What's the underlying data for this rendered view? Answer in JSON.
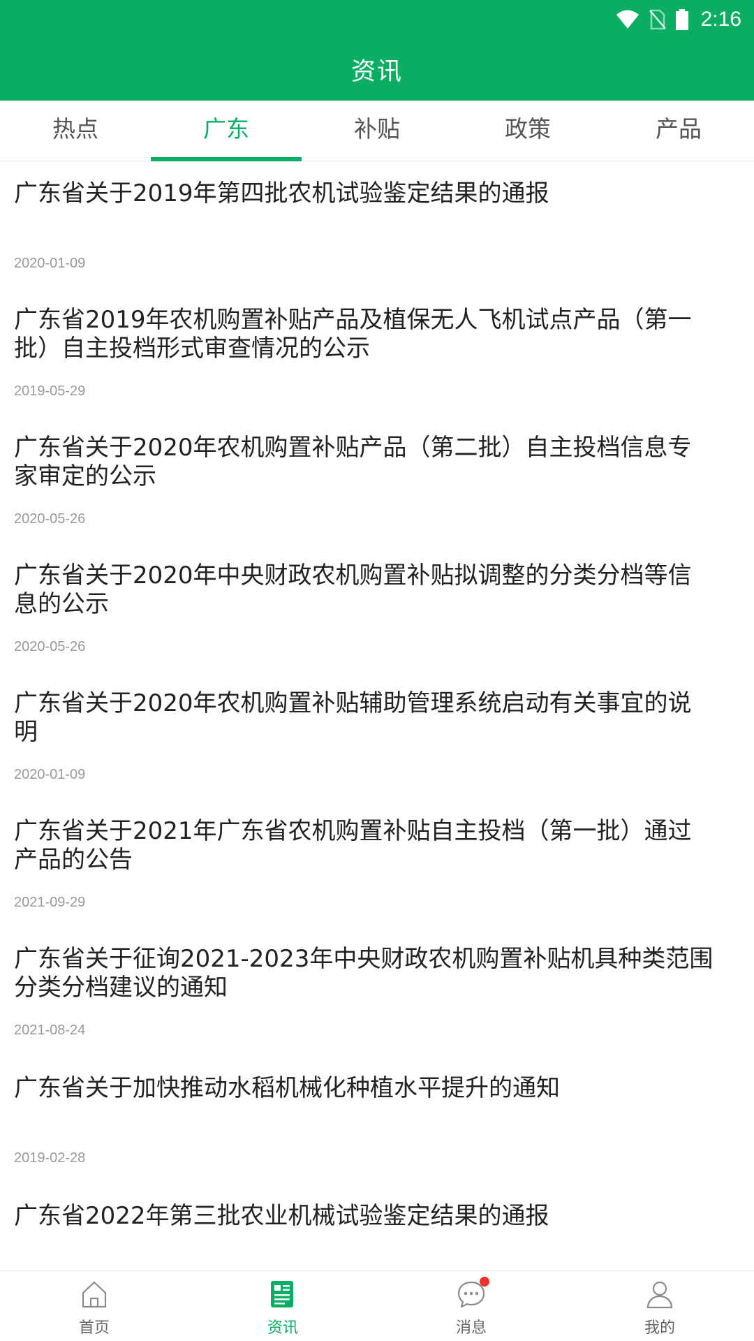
{
  "status_bar": {
    "time": "2:16",
    "icons": [
      "wifi-icon",
      "no-sim-icon",
      "battery-icon"
    ]
  },
  "header": {
    "title": "资讯"
  },
  "tabs": [
    {
      "label": "热点",
      "active": false
    },
    {
      "label": "广东",
      "active": true
    },
    {
      "label": "补贴",
      "active": false
    },
    {
      "label": "政策",
      "active": false
    },
    {
      "label": "产品",
      "active": false
    }
  ],
  "news": [
    {
      "title": "广东省关于2019年第四批农机试验鉴定结果的通报",
      "date": "2020-01-09"
    },
    {
      "title": "广东省2019年农机购置补贴产品及植保无人飞机试点产品（第一批）自主投档形式审查情况的公示",
      "date": "2019-05-29"
    },
    {
      "title": "广东省关于2020年农机购置补贴产品（第二批）自主投档信息专家审定的公示",
      "date": "2020-05-26"
    },
    {
      "title": "广东省关于2020年中央财政农机购置补贴拟调整的分类分档等信息的公示",
      "date": "2020-05-26"
    },
    {
      "title": "广东省关于2020年农机购置补贴辅助管理系统启动有关事宜的说明",
      "date": "2020-01-09"
    },
    {
      "title": "广东省关于2021年广东省农机购置补贴自主投档（第一批）通过产品的公告",
      "date": "2021-09-29"
    },
    {
      "title": "广东省关于征询2021-2023年中央财政农机购置补贴机具种类范围分类分档建议的通知",
      "date": "2021-08-24"
    },
    {
      "title": "广东省关于加快推动水稻机械化种植水平提升的通知",
      "date": "2019-02-28"
    },
    {
      "title": "广东省2022年第三批农业机械试验鉴定结果的通报",
      "date": ""
    }
  ],
  "bottom_nav": [
    {
      "label": "首页",
      "icon": "home-icon",
      "active": false
    },
    {
      "label": "资讯",
      "icon": "news-icon",
      "active": true
    },
    {
      "label": "消息",
      "icon": "message-icon",
      "active": false,
      "badge": true
    },
    {
      "label": "我的",
      "icon": "user-icon",
      "active": false
    }
  ],
  "colors": {
    "primary": "#0aae62",
    "badge": "#f23030",
    "text": "#222222",
    "date": "#999999"
  }
}
